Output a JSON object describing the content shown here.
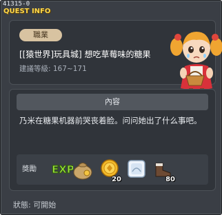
{
  "window": {
    "quest_id": "41315-0",
    "title": "QUEST INFO"
  },
  "quest": {
    "category": "職業",
    "name": "[[猿世界]玩具城] 想吃草莓味的糖果",
    "level_range": "建議等級: 167~171",
    "npc_icon": "npc-girl-with-basket"
  },
  "details": {
    "header": "內容",
    "description": "乃米在糖果机器前哭丧着脸。问问她出了什么事吧。"
  },
  "rewards": {
    "label": "獎勵",
    "exp_label": "EXP",
    "items": [
      {
        "icon": "money-bag-icon",
        "count": ""
      },
      {
        "icon": "coin-icon",
        "count": "20"
      },
      {
        "icon": "ice-cube-icon",
        "count": ""
      },
      {
        "icon": "boot-icon",
        "count": "80"
      }
    ]
  },
  "status": {
    "text": "狀態: 可開始"
  }
}
